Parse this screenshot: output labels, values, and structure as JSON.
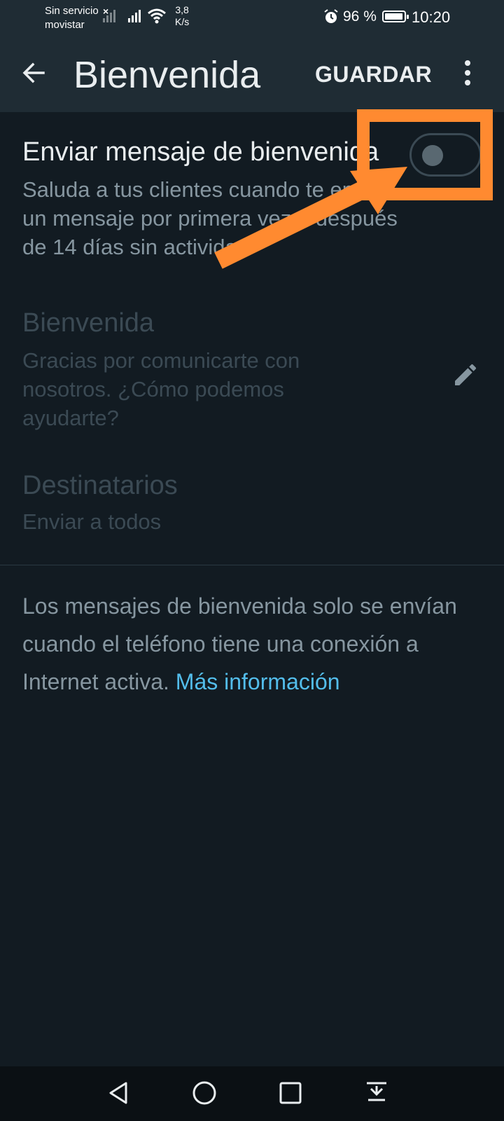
{
  "status_bar": {
    "carrier_line1": "Sin servicio",
    "carrier_line2": "movistar",
    "speed_value": "3,8",
    "speed_unit": "K/s",
    "battery": "96 %",
    "battery_level": 0.96,
    "time": "10:20"
  },
  "app_bar": {
    "title": "Bienvenida",
    "save_label": "GUARDAR",
    "back_icon": "arrow-back-icon",
    "more_icon": "more-vert-icon"
  },
  "welcome_toggle": {
    "title": "Enviar mensaje de bienvenida",
    "subtitle": "Saluda a tus clientes cuando te envíen un mensaje por primera vez o después de 14 días sin actividad",
    "enabled": false
  },
  "welcome_message": {
    "title": "Bienvenida",
    "body": "Gracias por comunicarte con nosotros. ¿Cómo podemos ayudarte?",
    "edit_icon": "pencil-icon"
  },
  "recipients": {
    "title": "Destinatarios",
    "value": "Enviar a todos"
  },
  "info": {
    "text": "Los mensajes de bienvenida solo se envían cuando el teléfono tiene una conexión a Internet activa. ",
    "link": "Más información"
  },
  "colors": {
    "background": "#121b22",
    "app_bar": "#1f2c34",
    "accent_link": "#53bdeb",
    "annotation": "#ff8a30"
  },
  "nav_bar": {
    "icons": [
      "back-triangle-icon",
      "home-circle-icon",
      "recents-square-icon",
      "notification-pull-icon"
    ]
  }
}
